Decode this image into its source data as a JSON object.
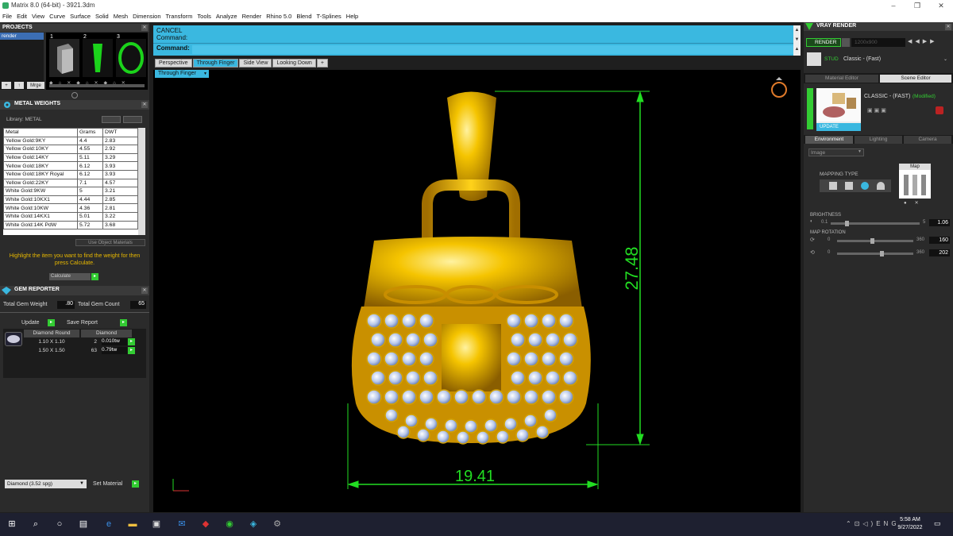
{
  "window": {
    "title": "Matrix 8.0 (64-bit) - 3921.3dm",
    "min": "–",
    "max": "❐",
    "close": "✕"
  },
  "menu": [
    "File",
    "Edit",
    "View",
    "Curve",
    "Surface",
    "Solid",
    "Mesh",
    "Dimension",
    "Transform",
    "Tools",
    "Analyze",
    "Render",
    "Rhino 5.0",
    "Blend",
    "T-Splines",
    "Help"
  ],
  "projects": {
    "title": "PROJECTS",
    "item": "render",
    "thumb_numbers": [
      "1",
      "2",
      "3"
    ],
    "buttons": {
      "add": "+",
      "up": "↑",
      "merge": "Mrge"
    }
  },
  "metal_weights": {
    "title": "METAL WEIGHTS",
    "library_label": "Library: METAL",
    "columns": [
      "Metal",
      "Grams",
      "DWT"
    ],
    "rows": [
      [
        "Yellow Gold:9KY",
        "4.4",
        "2.83"
      ],
      [
        "Yellow Gold:10KY",
        "4.55",
        "2.92"
      ],
      [
        "Yellow Gold:14KY",
        "5.11",
        "3.29"
      ],
      [
        "Yellow Gold:18KY",
        "6.12",
        "3.93"
      ],
      [
        "Yellow Gold:18KY Royal",
        "6.12",
        "3.93"
      ],
      [
        "Yellow Gold:22KY",
        "7.1",
        "4.57"
      ],
      [
        "White Gold:9KW",
        "5",
        "3.21"
      ],
      [
        "White Gold:10KX1",
        "4.44",
        "2.85"
      ],
      [
        "White Gold:10KW",
        "4.36",
        "2.81"
      ],
      [
        "White Gold:14KX1",
        "5.01",
        "3.22"
      ],
      [
        "White Gold:14K PdW",
        "5.72",
        "3.68"
      ]
    ],
    "use_object_materials": "Use Object Materials",
    "hint": "Highlight the item you want to find the weight for then press Calculate.",
    "calculate": "Calculate"
  },
  "gem_reporter": {
    "title": "GEM REPORTER",
    "total_weight_label": "Total Gem Weight",
    "total_weight": ".80",
    "total_count_label": "Total Gem Count",
    "total_count": "65",
    "update": "Update",
    "save_report": "Save Report",
    "gem_header": [
      "Diamond Round",
      "Diamond"
    ],
    "gem_rows": [
      [
        "1.10 X 1.10",
        "2",
        "0.010tw"
      ],
      [
        "1.50 X 1.50",
        "63",
        "0.79tw"
      ]
    ],
    "material_select": "Diamond   (3.52 spg)",
    "set_material": "Set Material"
  },
  "command": {
    "cancel": "CANCEL",
    "prompt1": "Command:",
    "prompt2": "Command:"
  },
  "viewport_tabs": [
    "Perspective",
    "Through Finger",
    "Side View",
    "Looking Down"
  ],
  "viewport_add": "+",
  "active_view": "Through Finger",
  "dimensions": {
    "height": "27.48",
    "width": "19.41"
  },
  "vray": {
    "title": "VRAY RENDER",
    "render": "RENDER",
    "resolution": "1200x900",
    "preset_label": "STUD",
    "preset": "Classic - (Fast)",
    "tabs": [
      "Material Editor",
      "Scene Editor"
    ],
    "material_name": "CLASSIC - (FAST)",
    "modified": "(Modified)",
    "update": "UPDATE",
    "env_tabs": [
      "Environment",
      "Lighting",
      "Camera"
    ],
    "env_type": "Image",
    "mapping_type": "MAPPING TYPE",
    "map_label": "Map",
    "brightness_label": "BRIGHTNESS",
    "brightness_min": "0.1",
    "brightness_max": "5",
    "brightness": "1.06",
    "map_rotation_label": "MAP ROTATION",
    "rot1_min": "0",
    "rot1_max": "360",
    "rot1": "160",
    "rot2_min": "0",
    "rot2_max": "360",
    "rot2": "202"
  },
  "taskbar": {
    "time": "5:58 AM",
    "date": "9/27/2022"
  },
  "colors": {
    "accent": "#3ab8e0",
    "gold": "#e0a800",
    "green_dim": "#22dd22"
  }
}
